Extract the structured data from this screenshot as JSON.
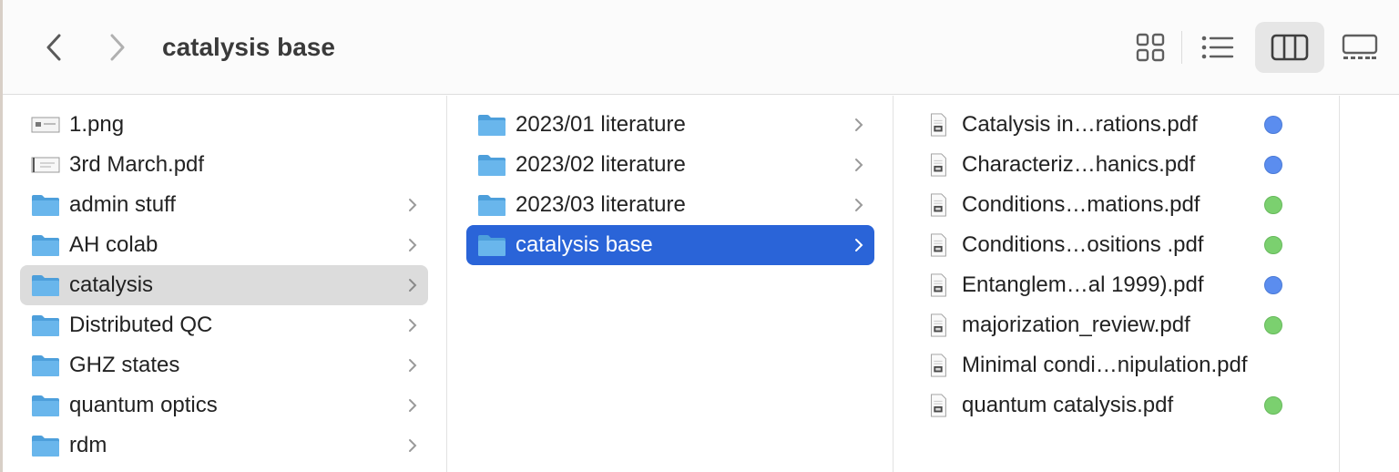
{
  "window": {
    "title": "catalysis base"
  },
  "toolbar": {
    "back_icon": "chevron-left-icon",
    "forward_icon": "chevron-right-icon",
    "view_modes": [
      {
        "name": "icon-view",
        "icon": "grid-icon"
      },
      {
        "name": "list-view",
        "icon": "list-icon"
      },
      {
        "name": "column-view",
        "icon": "columns-icon",
        "active": true
      },
      {
        "name": "gallery-view",
        "icon": "gallery-icon"
      }
    ]
  },
  "column1": {
    "items": [
      {
        "label": "1.png",
        "kind": "image"
      },
      {
        "label": "3rd March.pdf",
        "kind": "document"
      },
      {
        "label": "admin stuff",
        "kind": "folder"
      },
      {
        "label": "AH colab",
        "kind": "folder"
      },
      {
        "label": "catalysis",
        "kind": "folder",
        "selected": "inactive"
      },
      {
        "label": "Distributed QC",
        "kind": "folder"
      },
      {
        "label": "GHZ states",
        "kind": "folder"
      },
      {
        "label": "quantum optics",
        "kind": "folder"
      },
      {
        "label": "rdm",
        "kind": "folder"
      }
    ]
  },
  "column2": {
    "items": [
      {
        "label": "2023/01 literature",
        "kind": "folder"
      },
      {
        "label": "2023/02 literature",
        "kind": "folder"
      },
      {
        "label": "2023/03 literature",
        "kind": "folder"
      },
      {
        "label": "catalysis base",
        "kind": "folder",
        "selected": "active"
      }
    ]
  },
  "column3": {
    "items": [
      {
        "label": "Catalysis in…rations.pdf",
        "tag": "blue"
      },
      {
        "label": "Characteriz…hanics.pdf",
        "tag": "blue"
      },
      {
        "label": "Conditions…mations.pdf",
        "tag": "green"
      },
      {
        "label": "Conditions…ositions .pdf",
        "tag": "green"
      },
      {
        "label": "Entanglem…al 1999).pdf",
        "tag": "blue"
      },
      {
        "label": "majorization_review.pdf",
        "tag": "green"
      },
      {
        "label": "Minimal condi…nipulation.pdf",
        "tag": ""
      },
      {
        "label": "quantum catalysis.pdf",
        "tag": "green"
      }
    ]
  },
  "colors": {
    "selection_active": "#2a64d8",
    "selection_inactive": "#dcdcdc",
    "folder": "#5aaee8",
    "tag_blue": "#5b8def",
    "tag_green": "#7bd06f"
  }
}
